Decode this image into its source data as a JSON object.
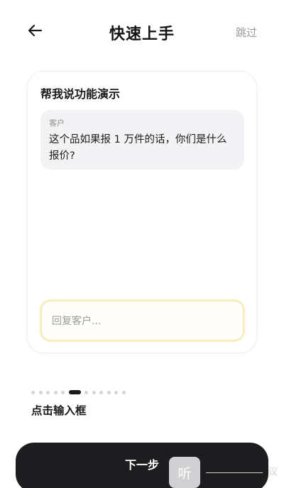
{
  "header": {
    "back_icon": "arrow-left-icon",
    "title": "快速上手",
    "skip_label": "跳过"
  },
  "demo_card": {
    "title": "帮我说功能演示",
    "message": {
      "sender": "客户",
      "text": "这个品如果报 1 万件的话，你们是什么报价?"
    },
    "reply_input": {
      "placeholder": "回复客户..."
    },
    "accent_color": "#f7e9b4"
  },
  "pager": {
    "total": 12,
    "active_index": 5
  },
  "step_caption": "点击输入框",
  "primary_button": {
    "label": "下一步"
  },
  "overlay": {
    "listen_label": "听",
    "tail_text": "议"
  }
}
